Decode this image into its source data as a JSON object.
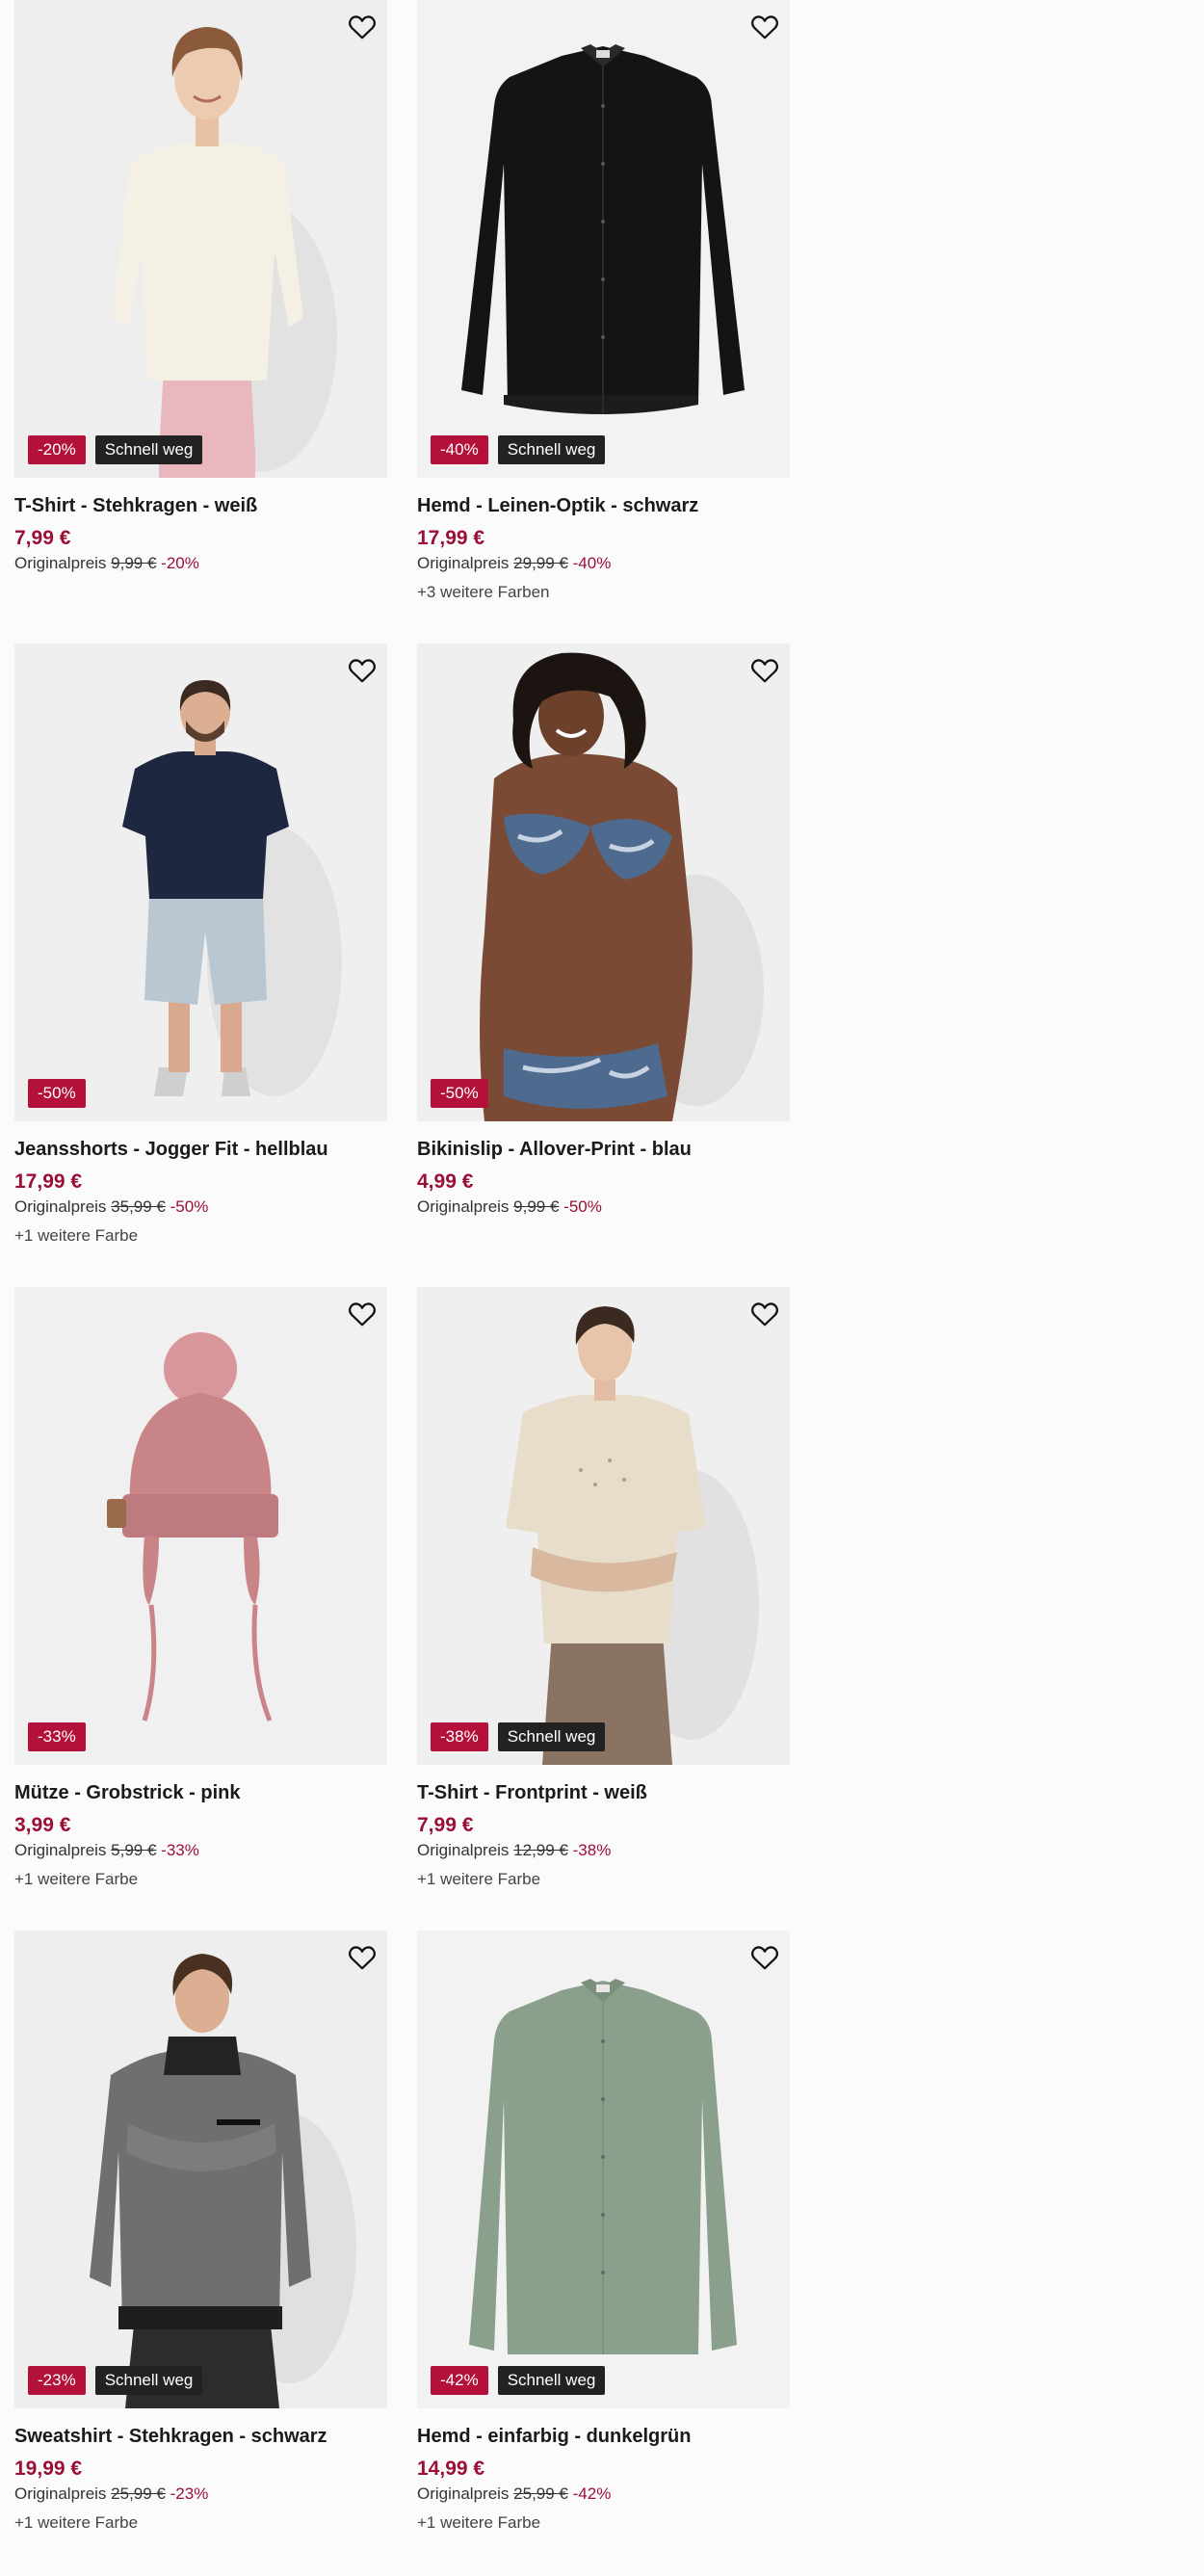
{
  "colors": {
    "discount_badge": "#b3103a",
    "quick_badge": "#222222",
    "price": "#9b0f36",
    "background": "#fbfbfb"
  },
  "products": [
    {
      "title": "T-Shirt - Stehkragen - weiß",
      "price": "7,99 €",
      "original_label": "Originalpreis",
      "original_price": "9,99 €",
      "discount": "-20%",
      "discount_badge": "-20%",
      "quick_badge": "Schnell weg",
      "more_colors": "",
      "image": "woman-cream-sweater"
    },
    {
      "title": "Hemd - Leinen-Optik - schwarz",
      "price": "17,99 €",
      "original_label": "Originalpreis",
      "original_price": "29,99 €",
      "discount": "-40%",
      "discount_badge": "-40%",
      "quick_badge": "Schnell weg",
      "more_colors": "+3 weitere Farben",
      "image": "black-shirt"
    },
    {
      "title": "Jeansshorts - Jogger Fit - hellblau",
      "price": "17,99 €",
      "original_label": "Originalpreis",
      "original_price": "35,99 €",
      "discount": "-50%",
      "discount_badge": "-50%",
      "quick_badge": "",
      "more_colors": "+1 weitere Farbe",
      "image": "man-polo-shorts"
    },
    {
      "title": "Bikinislip - Allover-Print - blau",
      "price": "4,99 €",
      "original_label": "Originalpreis",
      "original_price": "9,99 €",
      "discount": "-50%",
      "discount_badge": "-50%",
      "quick_badge": "",
      "more_colors": "",
      "image": "woman-bikini"
    },
    {
      "title": "Mütze - Grobstrick - pink",
      "price": "3,99 €",
      "original_label": "Originalpreis",
      "original_price": "5,99 €",
      "discount": "-33%",
      "discount_badge": "-33%",
      "quick_badge": "",
      "more_colors": "+1 weitere Farbe",
      "image": "pink-knit-hat"
    },
    {
      "title": "T-Shirt - Frontprint - weiß",
      "price": "7,99 €",
      "original_label": "Originalpreis",
      "original_price": "12,99 €",
      "discount": "-38%",
      "discount_badge": "-38%",
      "quick_badge": "Schnell weg",
      "more_colors": "+1 weitere Farbe",
      "image": "woman-beige-tshirt"
    },
    {
      "title": "Sweatshirt - Stehkragen - schwarz",
      "price": "19,99 €",
      "original_label": "Originalpreis",
      "original_price": "25,99 €",
      "discount": "-23%",
      "discount_badge": "-23%",
      "quick_badge": "Schnell weg",
      "more_colors": "+1 weitere Farbe",
      "image": "man-grey-sweatshirt"
    },
    {
      "title": "Hemd - einfarbig - dunkelgrün",
      "price": "14,99 €",
      "original_label": "Originalpreis",
      "original_price": "25,99 €",
      "discount": "-42%",
      "discount_badge": "-42%",
      "quick_badge": "Schnell weg",
      "more_colors": "+1 weitere Farbe",
      "image": "green-shirt"
    }
  ]
}
